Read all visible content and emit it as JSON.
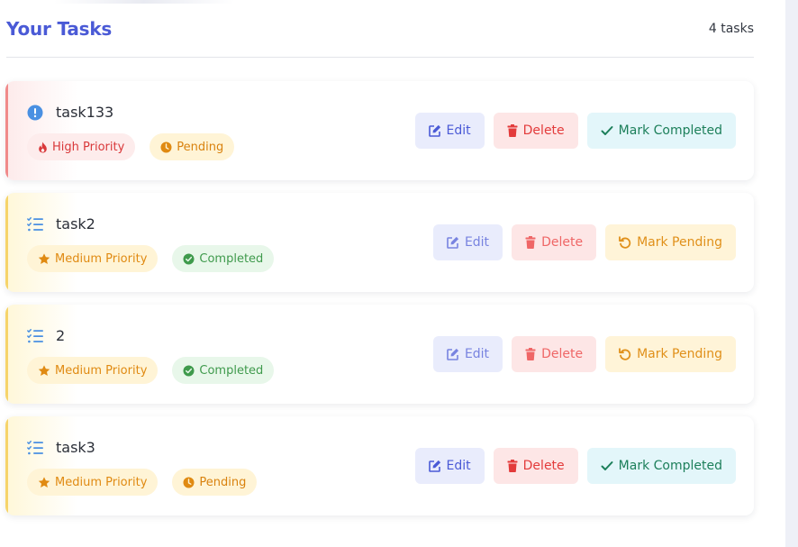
{
  "header": {
    "title": "Your Tasks",
    "count": "4 tasks"
  },
  "tasks": [
    {
      "title": "task133",
      "priority": "high",
      "status": "pending",
      "icon": "exclamation-circle-icon",
      "priority_label": "High Priority",
      "status_label": "Pending",
      "edit_label": "Edit",
      "delete_label": "Delete",
      "toggle_label": "Mark Completed"
    },
    {
      "title": "task2",
      "priority": "medium",
      "status": "completed",
      "icon": "list-check-icon",
      "priority_label": "Medium Priority",
      "status_label": "Completed",
      "edit_label": "Edit",
      "delete_label": "Delete",
      "toggle_label": "Mark Pending"
    },
    {
      "title": "2",
      "priority": "medium",
      "status": "completed",
      "icon": "list-check-icon",
      "priority_label": "Medium Priority",
      "status_label": "Completed",
      "edit_label": "Edit",
      "delete_label": "Delete",
      "toggle_label": "Mark Pending"
    },
    {
      "title": "task3",
      "priority": "medium",
      "status": "pending",
      "icon": "list-check-icon",
      "priority_label": "Medium Priority",
      "status_label": "Pending",
      "edit_label": "Edit",
      "delete_label": "Delete",
      "toggle_label": "Mark Completed"
    }
  ],
  "colors": {
    "accent": "#4a5ad6",
    "high": "#d9383a",
    "medium": "#e08a12",
    "completed": "#3f9a4c",
    "delete": "#e33b3b",
    "complete_button": "#1c7f5a"
  }
}
